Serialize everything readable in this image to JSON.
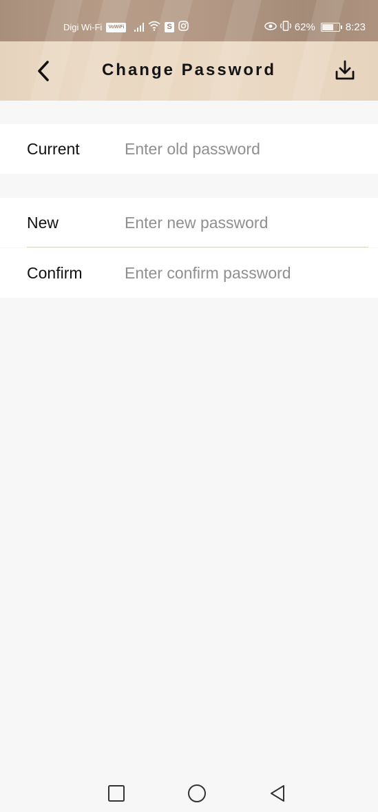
{
  "status_bar": {
    "carrier": "Digi Wi-Fi",
    "vowifi": "VoWiFi",
    "s_badge": "S",
    "battery_percent": "62%",
    "time": "8:23"
  },
  "header": {
    "title": "Change Password",
    "back_icon": "chevron-left-icon",
    "action_icon": "download-icon"
  },
  "form": {
    "current": {
      "label": "Current",
      "placeholder": "Enter old password",
      "value": ""
    },
    "new": {
      "label": "New",
      "placeholder": "Enter new password",
      "value": ""
    },
    "confirm": {
      "label": "Confirm",
      "placeholder": "Enter confirm password",
      "value": ""
    }
  },
  "nav_bar": {
    "recent_icon": "square-icon",
    "home_icon": "circle-icon",
    "back_icon": "triangle-back-icon"
  },
  "colors": {
    "header_bg": "#e9d7c1",
    "status_bg": "#ad937f",
    "page_bg": "#f7f7f7",
    "divider": "#d9d3c2",
    "placeholder": "#8f8f8f"
  }
}
